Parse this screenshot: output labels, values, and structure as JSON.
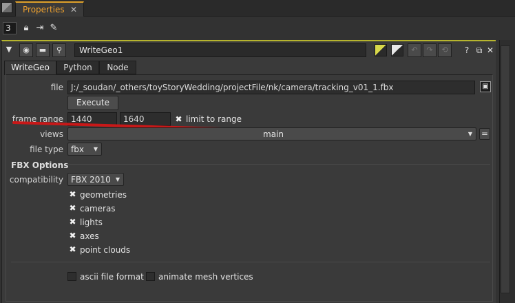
{
  "tabbar": {
    "tab_label": "Properties",
    "tab_close": "✕"
  },
  "toolbar": {
    "max_panels_value": "3",
    "icons": [
      "lock-icon",
      "clear-panels-icon",
      "pencil-icon"
    ]
  },
  "node": {
    "name": "WriteGeo1",
    "header_icons": [
      "collapse-triangle-icon",
      "view-node-icon",
      "center-node-icon",
      "float-panel-icon"
    ],
    "right_icons": [
      "node-color-icon",
      "gl-color-icon",
      "undo-icon",
      "redo-icon",
      "revert-icon"
    ],
    "help": "?",
    "float": "⧉",
    "close": "✕"
  },
  "tabs": [
    {
      "label": "WriteGeo",
      "active": true
    },
    {
      "label": "Python",
      "active": false
    },
    {
      "label": "Node",
      "active": false
    }
  ],
  "knobs": {
    "file_label": "file",
    "file_value": "J:/_soudan/_others/toyStoryWedding/projectFile/nk/camera/tracking_v01_1.fbx",
    "execute_label": "Execute",
    "frame_range_label": "frame range",
    "frame_start": "1440",
    "frame_end": "1640",
    "limit_label": "limit to range",
    "limit_checked": true,
    "views_label": "views",
    "views_value": "main",
    "views_eq": "=",
    "file_type_label": "file type",
    "file_type_value": "fbx"
  },
  "fbx": {
    "section_title": "FBX Options",
    "compat_label": "compatibility",
    "compat_value": "FBX 2010",
    "options": [
      {
        "label": "geometries",
        "checked": true
      },
      {
        "label": "cameras",
        "checked": true
      },
      {
        "label": "lights",
        "checked": true
      },
      {
        "label": "axes",
        "checked": true
      },
      {
        "label": "point clouds",
        "checked": true
      }
    ],
    "ascii_label": "ascii file format",
    "ascii_checked": false,
    "animate_label": "animate mesh vertices",
    "animate_checked": false
  },
  "colors": {
    "accent_orange": "#f0a22e",
    "panel_border_yellow": "#b7b52e",
    "annotation_red": "#c81818",
    "background": "#323232"
  }
}
